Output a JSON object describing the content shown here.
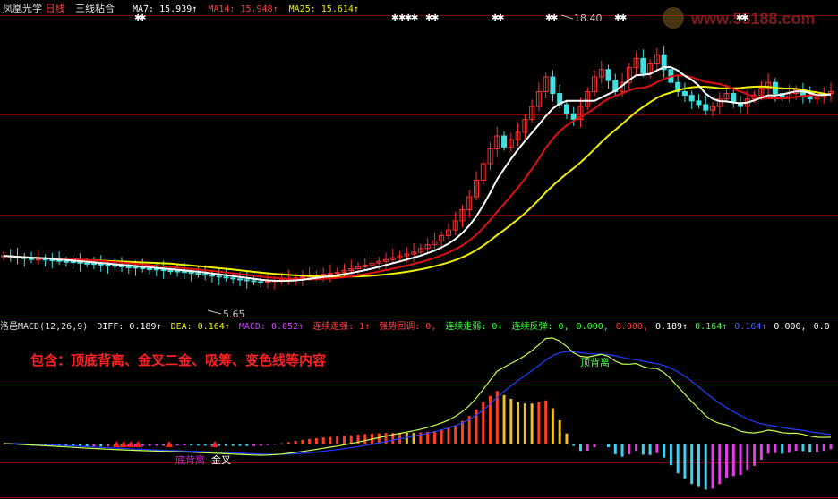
{
  "header": {
    "stock_name": "凤凰光学",
    "period": "日线",
    "indicator": "三线粘合",
    "ma7_label": "MA7:",
    "ma7_value": "15.939↑",
    "ma14_label": "MA14:",
    "ma14_value": "15.948↑",
    "ma25_label": "MA25:",
    "ma25_value": "15.614↑"
  },
  "watermark": {
    "text": "www.55188.com"
  },
  "macd_header": {
    "title": "洛邑MACD(12,26,9)",
    "diff": "DIFF: 0.189↑",
    "dea": "DEA: 0.164↑",
    "macd": "MACD: 0.052↑",
    "up_strong": "连续走强: 1↑",
    "pullback": "强势回调: 0,",
    "down_weak": "连续走弱: 0↓",
    "rebound": "连续反弹: 0,",
    "v1": "0.000,",
    "v2": "0.000,",
    "v3": "0.189↑",
    "v4": "0.164↑",
    "v5": "0.164↑",
    "v6": "0.000,",
    "v7": "0.0"
  },
  "annotations": {
    "promo": "包含：顶底背离、金叉二金、吸筹、变色线等内容",
    "top_divergence": "顶背离",
    "bottom_divergence": "底背离",
    "golden_cross": "金叉",
    "high_price": "18.40",
    "low_price": "5.65"
  },
  "colors": {
    "candle_up": "#ff3030",
    "candle_down": "#40e0e0",
    "ma7": "#ffffff",
    "ma14": "#e01010",
    "ma25": "#f0f000",
    "diff": "#c8ff50",
    "dea": "#2040ff",
    "grid": "#800000"
  },
  "chart_data": [
    {
      "type": "candlestick",
      "title": "凤凰光学 日线",
      "ylim": [
        4,
        20
      ],
      "ma_series": [
        {
          "name": "MA7",
          "value": 15.939
        },
        {
          "name": "MA14",
          "value": 15.948
        },
        {
          "name": "MA25",
          "value": 15.614
        }
      ],
      "extremes": {
        "high": 18.4,
        "low": 5.65
      },
      "closes": [
        7.1,
        7.05,
        7.0,
        6.95,
        6.9,
        6.92,
        6.88,
        6.85,
        6.8,
        6.78,
        6.75,
        6.7,
        6.68,
        6.65,
        6.6,
        6.58,
        6.55,
        6.5,
        6.48,
        6.45,
        6.4,
        6.38,
        6.35,
        6.3,
        6.28,
        6.25,
        6.2,
        6.15,
        6.1,
        6.05,
        6.0,
        5.95,
        5.9,
        5.85,
        5.8,
        5.75,
        5.7,
        5.68,
        5.72,
        5.75,
        5.8,
        5.85,
        5.9,
        5.95,
        6.0,
        6.05,
        6.1,
        6.15,
        6.2,
        6.3,
        6.4,
        6.5,
        6.6,
        6.7,
        6.8,
        6.9,
        7.0,
        7.1,
        7.2,
        7.3,
        7.5,
        7.7,
        7.9,
        8.2,
        8.5,
        9.0,
        9.6,
        10.3,
        11.2,
        12.1,
        12.9,
        13.6,
        13.0,
        13.4,
        13.8,
        14.5,
        15.2,
        16.0,
        16.8,
        15.9,
        15.3,
        14.8,
        14.5,
        15.2,
        16.0,
        16.8,
        17.2,
        16.6,
        16.0,
        16.5,
        17.3,
        17.8,
        17.0,
        17.5,
        18.0,
        17.2,
        16.5,
        16.0,
        15.8,
        15.5,
        15.3,
        15.0,
        15.2,
        15.6,
        15.9,
        15.4,
        15.2,
        15.6,
        15.8,
        16.2,
        16.5,
        15.9,
        15.7,
        15.9,
        16.1,
        15.8,
        15.6,
        15.7,
        15.9,
        16.0
      ]
    },
    {
      "type": "bar",
      "title": "洛邑MACD(12,26,9)",
      "series": [
        {
          "name": "DIFF",
          "value": 0.189
        },
        {
          "name": "DEA",
          "value": 0.164
        },
        {
          "name": "MACD",
          "value": 0.052
        }
      ]
    }
  ]
}
